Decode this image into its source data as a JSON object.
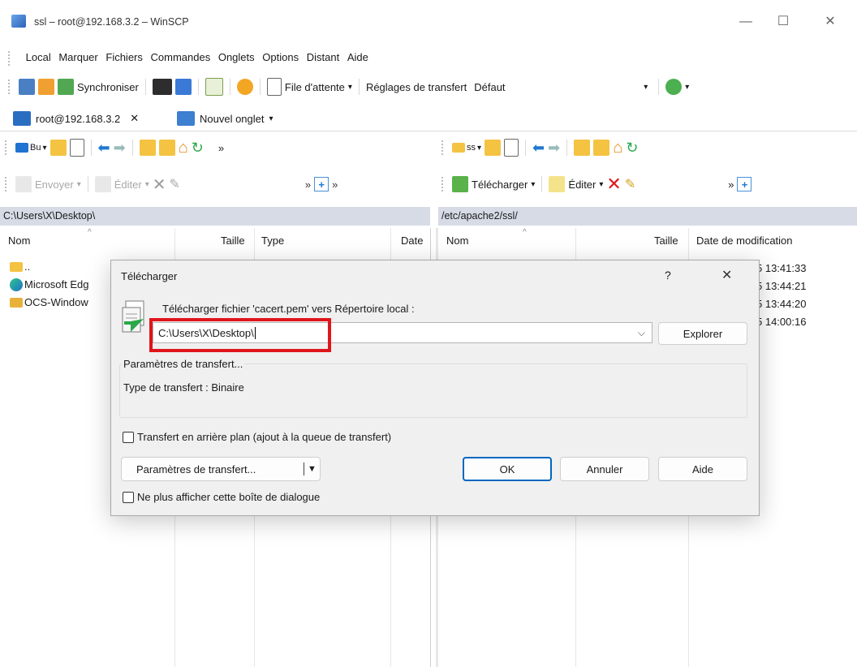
{
  "window": {
    "title": "ssl – root@192.168.3.2 – WinSCP"
  },
  "menu": [
    "Local",
    "Marquer",
    "Fichiers",
    "Commandes",
    "Onglets",
    "Options",
    "Distant",
    "Aide"
  ],
  "toolbar": {
    "synchronize_label": "Synchroniser",
    "queue_label": "File d'attente",
    "transfer_settings_label": "Réglages de transfert",
    "transfer_preset": "Défaut"
  },
  "tabs": {
    "session": "root@192.168.3.2",
    "new_tab": "Nouvel onglet"
  },
  "local": {
    "drive_label": "Bu",
    "send_label": "Envoyer",
    "edit_label": "Éditer",
    "path": "C:\\Users\\X\\Desktop\\",
    "columns": {
      "name": "Nom",
      "size": "Taille",
      "type": "Type",
      "date": "Date"
    },
    "files": [
      {
        "name": ".."
      },
      {
        "name": "Microsoft Edg"
      },
      {
        "name": "OCS-Window"
      }
    ]
  },
  "remote": {
    "drive_label": "ss",
    "download_label": "Télécharger",
    "edit_label": "Éditer",
    "path": "/etc/apache2/ssl/",
    "columns": {
      "name": "Nom",
      "size": "Taille",
      "modified": "Date de modification"
    },
    "dates": [
      "5 13:41:33",
      "5 13:44:21",
      "5 13:44:20",
      "5 14:00:16"
    ]
  },
  "dialog": {
    "title": "Télécharger",
    "help_glyph": "?",
    "prompt": "Télécharger fichier 'cacert.pem' vers Répertoire local :",
    "target_path": "C:\\Users\\X\\Desktop\\",
    "browse_label": "Explorer",
    "group_title": "Paramètres de transfert...",
    "transfer_type": "Type de transfert : Binaire",
    "background_label": "Transfert en arrière plan (ajout à la queue de transfert)",
    "settings_button": "Paramètres de transfert...",
    "ok": "OK",
    "cancel": "Annuler",
    "help": "Aide",
    "dont_show": "Ne plus afficher cette boîte de dialogue"
  },
  "colors": {
    "highlight": "#e0151b",
    "accent": "#0067c0",
    "pathbar": "#d6dbe6"
  }
}
